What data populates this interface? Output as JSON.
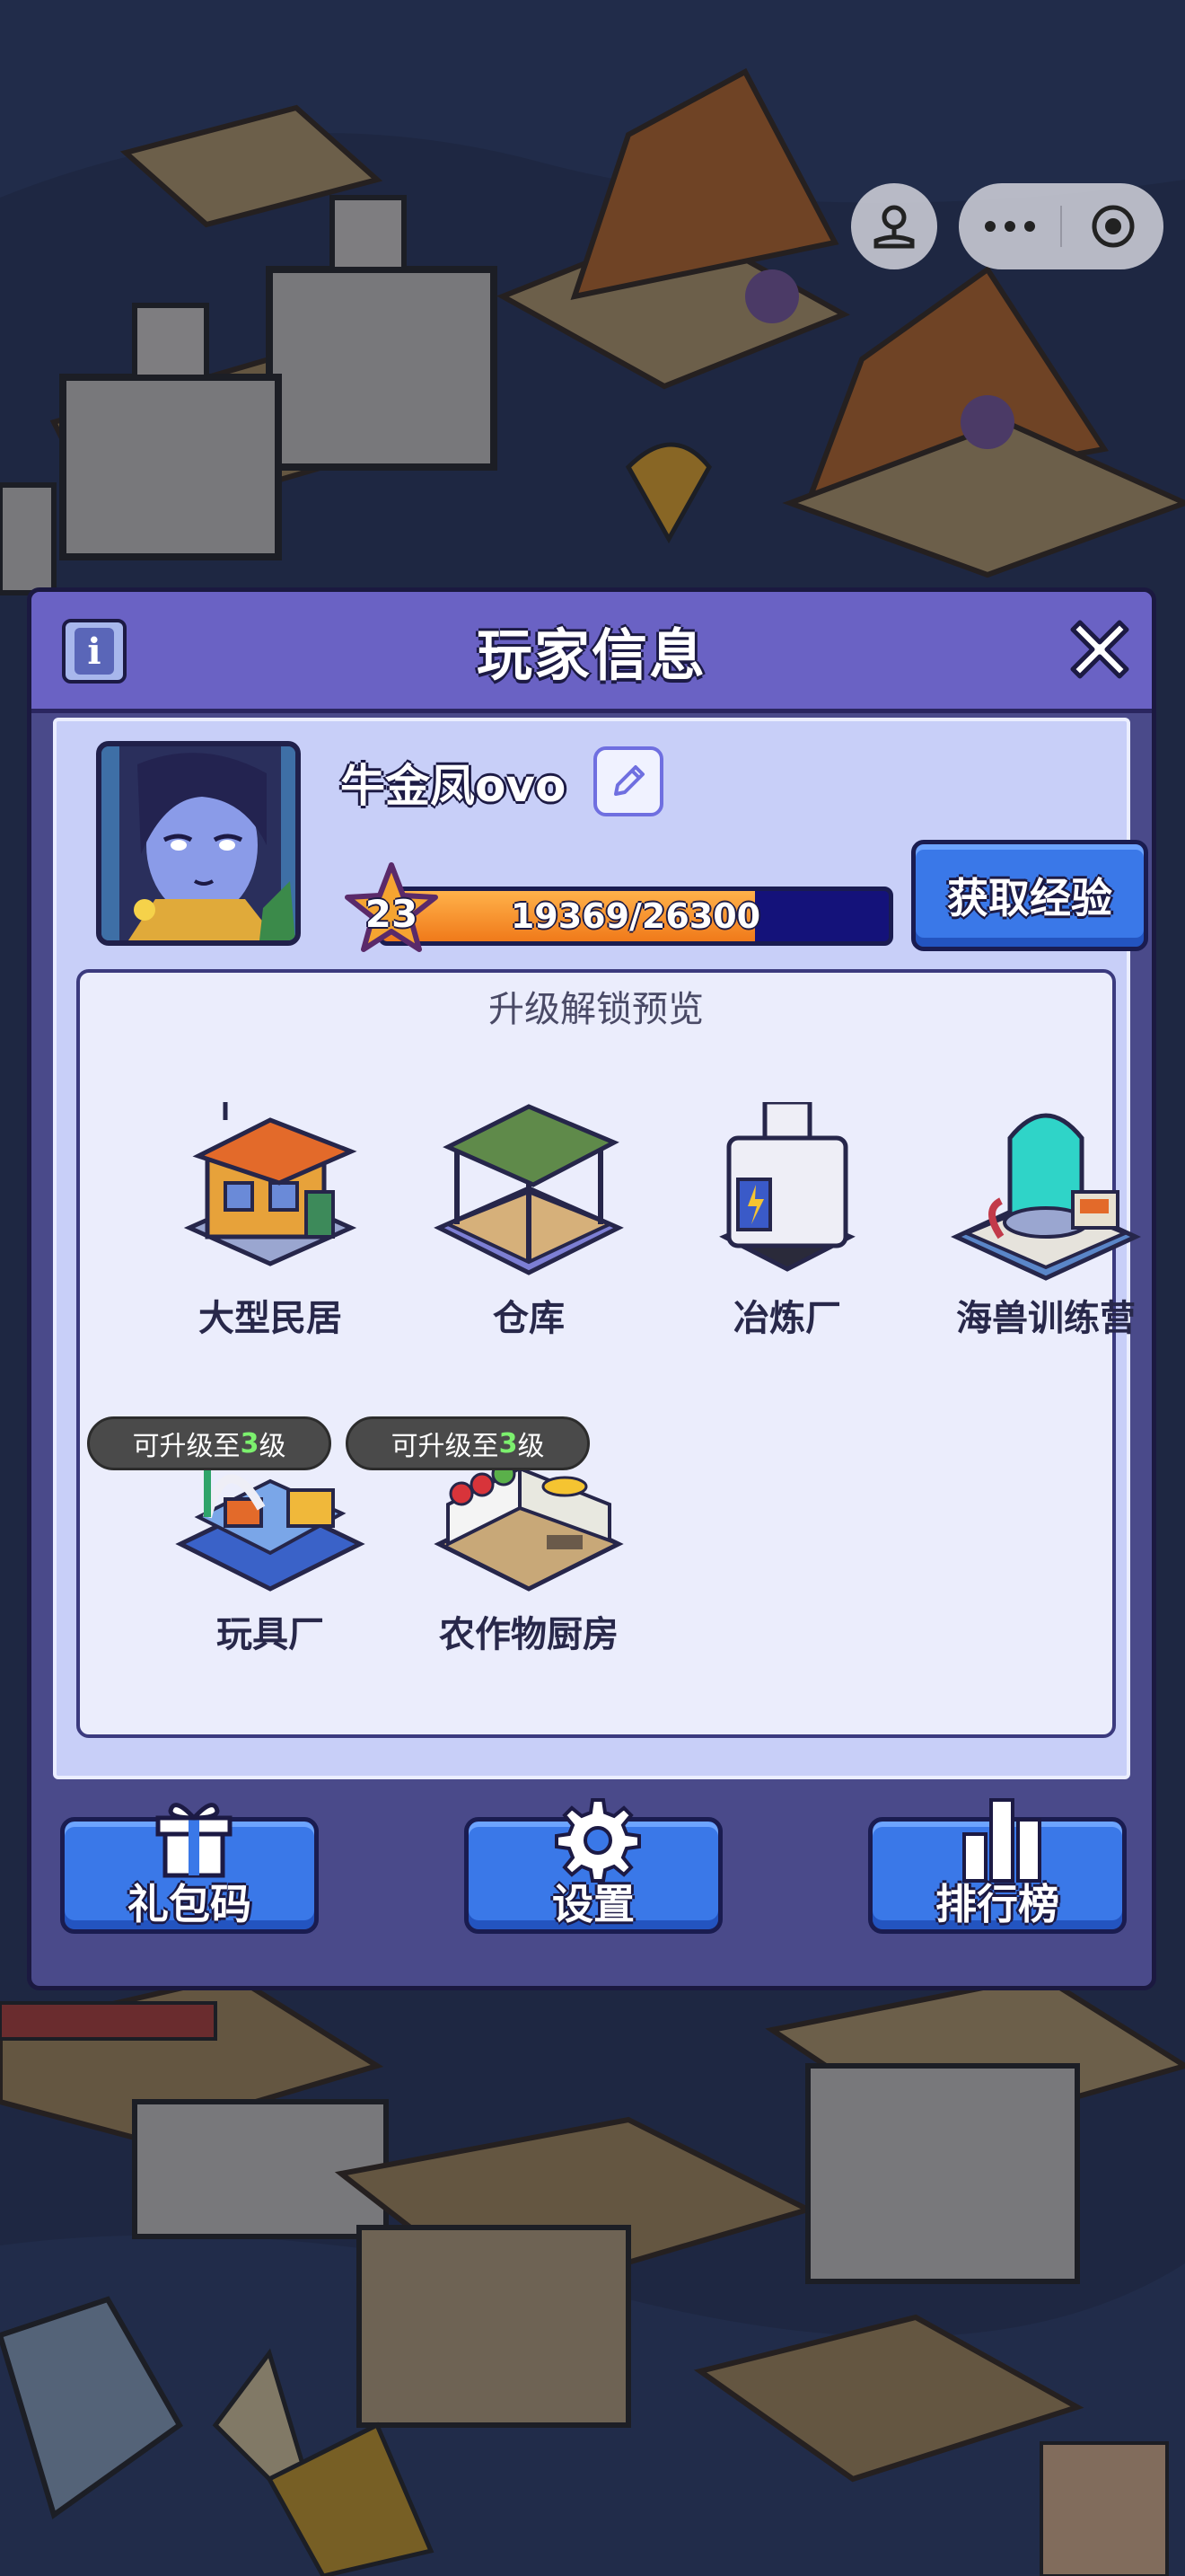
{
  "dialog": {
    "title": "玩家信息",
    "info_icon": "info-icon",
    "close_icon": "close-icon"
  },
  "player": {
    "name": "牛金凤ovo",
    "level": "23",
    "xp_text": "19369/26300",
    "xp_fraction": 0.7365,
    "get_exp_label": "获取经验"
  },
  "preview": {
    "title": "升级解锁预览",
    "buildings": [
      {
        "label": "大型民居",
        "icon": "house-icon"
      },
      {
        "label": "仓库",
        "icon": "warehouse-icon"
      },
      {
        "label": "冶炼厂",
        "icon": "smelter-icon"
      },
      {
        "label": "海兽训练营",
        "icon": "sea-beast-camp-icon"
      },
      {
        "label": "玩具厂",
        "icon": "toy-factory-icon"
      },
      {
        "label": "农作物厨房",
        "icon": "crop-kitchen-icon"
      }
    ],
    "badges": [
      {
        "prefix": "可升级至",
        "level": "3",
        "suffix": "级"
      },
      {
        "prefix": "可升级至",
        "level": "3",
        "suffix": "级"
      }
    ]
  },
  "buttons": {
    "gift_code": "礼包码",
    "settings": "设置",
    "leaderboard": "排行榜"
  },
  "colors": {
    "dialog_header": "#6a62c4",
    "dialog_body": "#4a4a8a",
    "button_blue": "#3a78e8",
    "xp_orange": "#f08a24",
    "badge_level_green": "#7cf06e"
  }
}
